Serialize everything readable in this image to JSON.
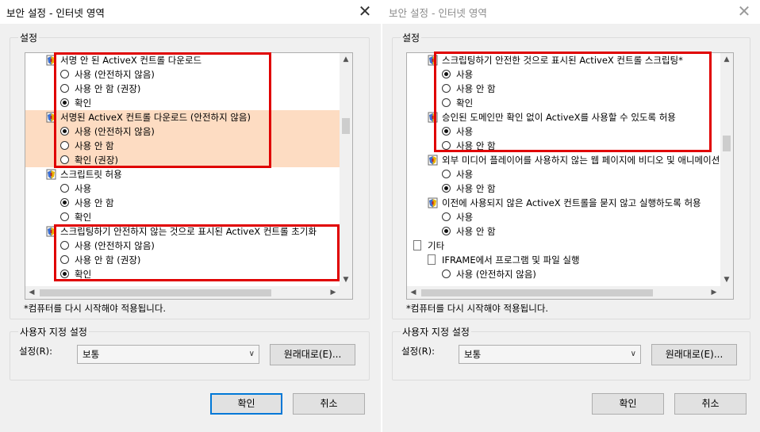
{
  "left": {
    "title": "보안 설정 - 인터넷 영역",
    "close": "✕",
    "group_label": "설정",
    "items": [
      {
        "type": "cat",
        "text": "서명 안 된 ActiveX 컨트롤 다운로드"
      },
      {
        "type": "opt",
        "text": "사용 (안전하지 않음)",
        "on": false
      },
      {
        "type": "opt",
        "text": "사용 안 함 (권장)",
        "on": false
      },
      {
        "type": "opt",
        "text": "확인",
        "on": true
      },
      {
        "type": "cat",
        "text": "서명된 ActiveX 컨트롤 다운로드 (안전하지 않음)",
        "hl": true
      },
      {
        "type": "opt",
        "text": "사용 (안전하지 않음)",
        "on": true,
        "hl": true
      },
      {
        "type": "opt",
        "text": "사용 안 함",
        "on": false,
        "hl": true
      },
      {
        "type": "opt",
        "text": "확인 (권장)",
        "on": false,
        "hl": true
      },
      {
        "type": "cat",
        "text": "스크립트릿 허용"
      },
      {
        "type": "opt",
        "text": "사용",
        "on": false
      },
      {
        "type": "opt",
        "text": "사용 안 함",
        "on": true
      },
      {
        "type": "opt",
        "text": "확인",
        "on": false
      },
      {
        "type": "cat",
        "text": "스크립팅하기 안전하지 않는 것으로 표시된 ActiveX 컨트롤 초기화"
      },
      {
        "type": "opt",
        "text": "사용 (안전하지 않음)",
        "on": false
      },
      {
        "type": "opt",
        "text": "사용 안 함 (권장)",
        "on": false
      },
      {
        "type": "opt",
        "text": "확인",
        "on": true
      }
    ],
    "restart_note": "*컴퓨터를 다시 시작해야 적용됩니다.",
    "custom_group_label": "사용자 지정 설정",
    "reset_label": "설정(R):",
    "reset_value": "보통",
    "reset_button": "원래대로(E)...",
    "ok": "확인",
    "cancel": "취소"
  },
  "right": {
    "title": "보안 설정 - 인터넷 영역",
    "close": "✕",
    "group_label": "설정",
    "items": [
      {
        "type": "cat",
        "text": "스크립팅하기 안전한 것으로 표시된 ActiveX 컨트롤 스크립팅*"
      },
      {
        "type": "opt",
        "text": "사용",
        "on": true
      },
      {
        "type": "opt",
        "text": "사용 안 함",
        "on": false
      },
      {
        "type": "opt",
        "text": "확인",
        "on": false
      },
      {
        "type": "cat",
        "text": "승인된 도메인만 확인 없이 ActiveX를 사용할 수 있도록 허용"
      },
      {
        "type": "opt",
        "text": "사용",
        "on": true
      },
      {
        "type": "opt",
        "text": "사용 안 함",
        "on": false
      },
      {
        "type": "cat",
        "text": "외부 미디어 플레이어를 사용하지 않는 웹 페이지에 비디오 및 애니메이션 표시"
      },
      {
        "type": "opt",
        "text": "사용",
        "on": false
      },
      {
        "type": "opt",
        "text": "사용 안 함",
        "on": true
      },
      {
        "type": "cat",
        "text": "이전에 사용되지 않은 ActiveX 컨트롤을 묻지 않고 실행하도록 허용"
      },
      {
        "type": "opt",
        "text": "사용",
        "on": false
      },
      {
        "type": "opt",
        "text": "사용 안 함",
        "on": true
      },
      {
        "type": "doc",
        "text": "기타"
      },
      {
        "type": "doc2",
        "text": "IFRAME에서 프로그램 및 파일 실행"
      },
      {
        "type": "opt",
        "text": "사용 (안전하지 않음)",
        "on": false
      }
    ],
    "restart_note": "*컴퓨터를 다시 시작해야 적용됩니다.",
    "custom_group_label": "사용자 지정 설정",
    "reset_label": "설정(R):",
    "reset_value": "보통",
    "reset_button": "원래대로(E)...",
    "ok": "확인",
    "cancel": "취소"
  },
  "colors": {
    "highlight_box": "#e00000",
    "selected_row": "#fddcc2",
    "primary_border": "#0078d7"
  },
  "icons": {
    "close": "close-icon",
    "setting": "shield-setting-icon",
    "doc": "document-icon",
    "scroll_up": "chevron-up-icon",
    "scroll_down": "chevron-down-icon"
  }
}
